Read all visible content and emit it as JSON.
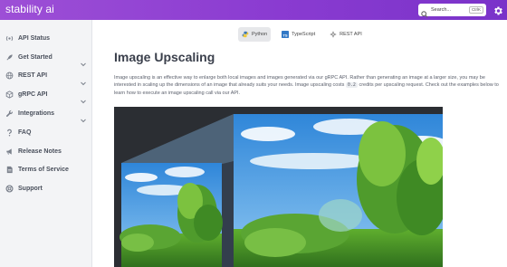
{
  "header": {
    "brand": "stability ai",
    "search_placeholder": "Search...",
    "search_shortcut": "CtrlK"
  },
  "sidebar": {
    "items": [
      {
        "label": "API Status",
        "icon": "broadcast-icon",
        "chevron": false
      },
      {
        "label": "Get Started",
        "icon": "rocket-icon",
        "chevron": true
      },
      {
        "label": "REST API",
        "icon": "globe-icon",
        "chevron": true
      },
      {
        "label": "gRPC API",
        "icon": "cube-icon",
        "chevron": true
      },
      {
        "label": "Integrations",
        "icon": "wrench-icon",
        "chevron": true
      },
      {
        "label": "FAQ",
        "icon": "question-icon",
        "chevron": false
      },
      {
        "label": "Release Notes",
        "icon": "megaphone-icon",
        "chevron": false
      },
      {
        "label": "Terms of Service",
        "icon": "document-icon",
        "chevron": false
      },
      {
        "label": "Support",
        "icon": "lifebuoy-icon",
        "chevron": false
      }
    ]
  },
  "languages": [
    {
      "label": "Python",
      "icon": "python-icon",
      "active": true
    },
    {
      "label": "TypeScript",
      "icon": "typescript-icon",
      "active": false
    },
    {
      "label": "REST API",
      "icon": "rest-api-icon",
      "active": false
    }
  ],
  "content": {
    "title": "Image Upscaling",
    "desc_part1": "Image upscaling is an effective way to enlarge both local images and images generated via our gRPC API. Rather than generating an image at a larger size, you may be interested in scaling up the dimensions of an image that already suits your needs. Image upscaling costs ",
    "cost_code": "0.2",
    "desc_part2": " credits per upscaling request. Check out the examples below to learn how to execute an image upscaling call via our API."
  },
  "colors": {
    "header_gradient_start": "#9d4fd6",
    "header_gradient_end": "#7a33c9",
    "sidebar_bg": "#f3f4f6"
  }
}
